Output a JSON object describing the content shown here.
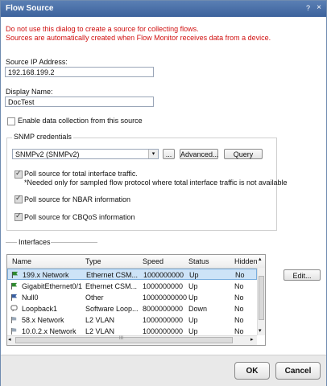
{
  "title": "Flow Source",
  "title_help": "?",
  "title_close": "×",
  "errors": [
    "Do not use this dialog to create a source for collecting flows.",
    "Sources are automatically created when Flow Monitor receives data from a device."
  ],
  "source_ip": {
    "label": "Source IP Address:",
    "value": "192.168.199.2"
  },
  "display_name": {
    "label": "Display Name:",
    "value": "DocTest"
  },
  "enable_collection": {
    "label": "Enable data collection from this source",
    "checked": false
  },
  "snmp": {
    "group_label": "SNMP credentials",
    "selected": "SNMPv2 (SNMPv2)",
    "dropdown_arrow": "▾",
    "ellipsis_label": "...",
    "advanced_label": "Advanced...",
    "query_label": "Query",
    "poll_total": {
      "label": "Poll source for total interface traffic.",
      "checked": true
    },
    "poll_total_note": "*Needed only for sampled flow protocol where total interface traffic is not available",
    "poll_nbar": {
      "label": "Poll source for NBAR information",
      "checked": true
    },
    "poll_cbqos": {
      "label": "Poll source for CBQoS information",
      "checked": true
    }
  },
  "interfaces": {
    "group_label": "Interfaces",
    "columns": [
      "Name",
      "Type",
      "Speed",
      "Status",
      "Hidden"
    ],
    "rows": [
      {
        "icon": "flag-icon",
        "name": "199.x Network",
        "type": "Ethernet CSM...",
        "speed": "1000000000",
        "status": "Up",
        "hidden": "No"
      },
      {
        "icon": "flag-icon",
        "name": "GigabitEthernet0/1",
        "type": "Ethernet CSM...",
        "speed": "1000000000",
        "status": "Up",
        "hidden": "No"
      },
      {
        "icon": "flag-icon",
        "name": "Null0",
        "type": "Other",
        "speed": "10000000000",
        "status": "Up",
        "hidden": "No"
      },
      {
        "icon": "bubble-icon",
        "name": "Loopback1",
        "type": "Software Loop...",
        "speed": "8000000000",
        "status": "Down",
        "hidden": "No"
      },
      {
        "icon": "vlan-icon",
        "name": "58.x Network",
        "type": "L2 VLAN",
        "speed": "1000000000",
        "status": "Up",
        "hidden": "No"
      },
      {
        "icon": "vlan-icon",
        "name": "10.0.2.x Network",
        "type": "L2 VLAN",
        "speed": "1000000000",
        "status": "Up",
        "hidden": "No"
      }
    ],
    "scroll_up": "▴",
    "scroll_down": "▾",
    "scroll_left": "◂",
    "scroll_right": "▸",
    "grip": "III",
    "edit_label": "Edit..."
  },
  "ok_label": "OK",
  "cancel_label": "Cancel",
  "colors": {
    "title_bar": "#4a6fa8",
    "error_text": "#d01010",
    "selection": "#cde3f7",
    "flag_green": "#2f8a2f"
  }
}
